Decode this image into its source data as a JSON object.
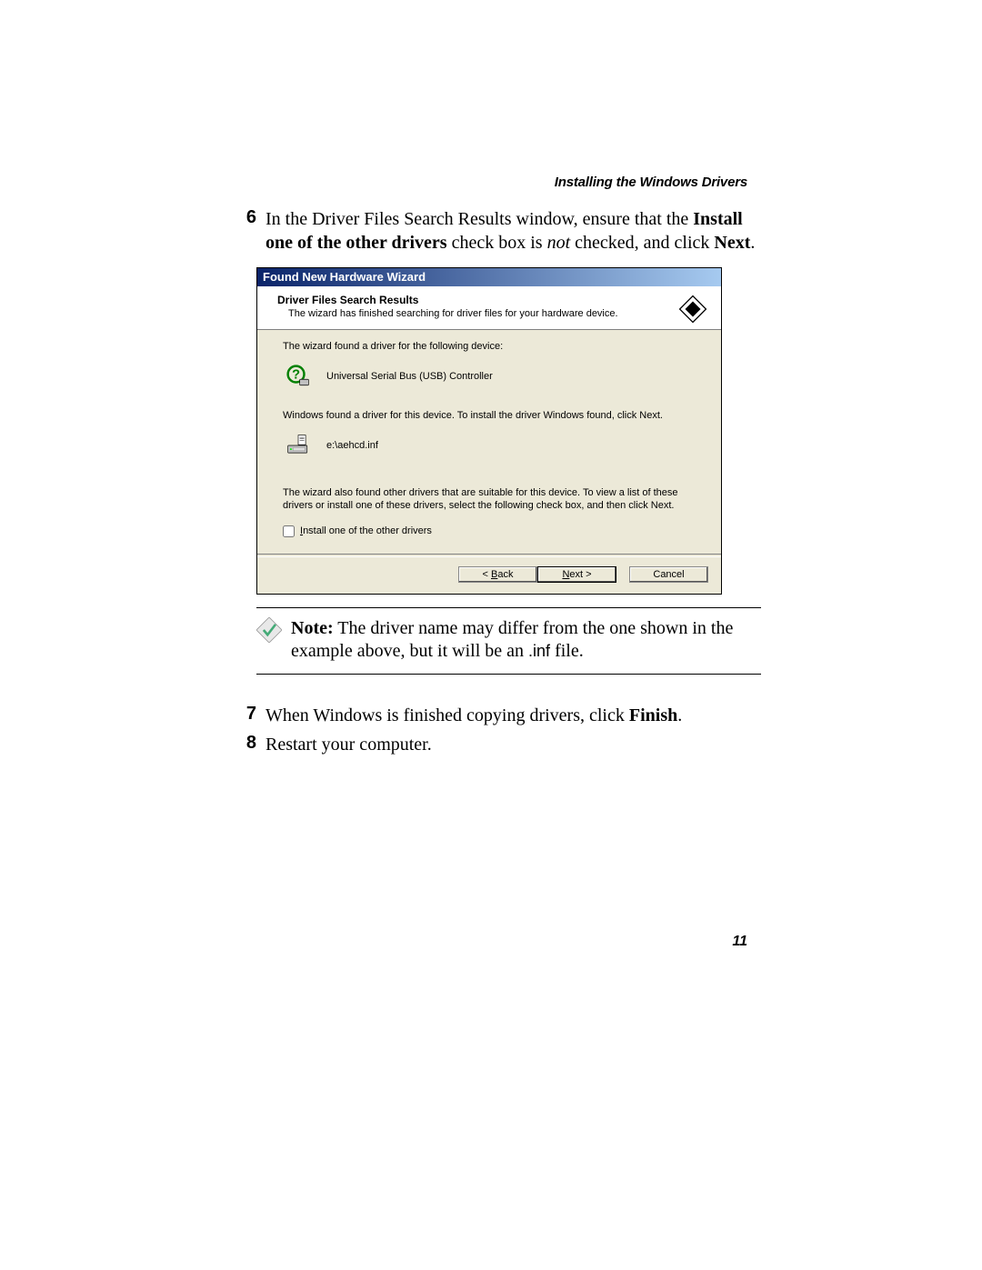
{
  "header_running": "Installing the Windows Drivers",
  "steps": {
    "s6": {
      "num": "6",
      "text_a": "In the Driver Files Search Results window, ensure that the ",
      "bold_a": "Install one of the other drivers",
      "text_b": " check box is ",
      "ital_a": "not",
      "text_c": " checked, and click ",
      "bold_b": "Next",
      "text_d": "."
    },
    "s7": {
      "num": "7",
      "text_a": "When Windows is finished copying drivers, click ",
      "bold_a": "Finish",
      "text_b": "."
    },
    "s8": {
      "num": "8",
      "text_a": "Restart your computer."
    }
  },
  "wizard": {
    "title": "Found New Hardware Wizard",
    "header_title": "Driver Files Search Results",
    "header_sub": "The wizard has finished searching for driver files for your hardware device.",
    "body_found": "The wizard found a driver for the following device:",
    "device_name": "Universal Serial Bus (USB) Controller",
    "install_note": "Windows found a driver for this device. To install the driver Windows found, click Next.",
    "file_path": "e:\\aehcd.inf",
    "other_text": "The wizard also found other drivers that are suitable for this device. To view a list of these drivers or install one of these drivers, select the following check box, and then click Next.",
    "checkbox_label_pre": "I",
    "checkbox_label_rest": "nstall one of the other drivers",
    "btn_back_pre": "< ",
    "btn_back_u": "B",
    "btn_back_rest": "ack",
    "btn_next_u": "N",
    "btn_next_rest": "ext >",
    "btn_cancel": "Cancel"
  },
  "note": {
    "label": "Note:",
    "text_a": " The driver name may differ from the one shown in the example above, but it will be an ",
    "inf": ".inf",
    "text_b": " file."
  },
  "page_number": "11"
}
